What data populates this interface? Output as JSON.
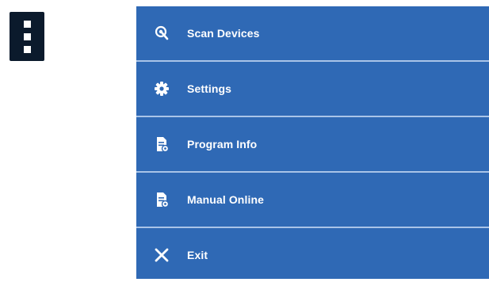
{
  "menu": {
    "items": [
      {
        "label": "Scan Devices",
        "icon": "scan-icon"
      },
      {
        "label": "Settings",
        "icon": "gear-icon"
      },
      {
        "label": "Program Info",
        "icon": "document-icon"
      },
      {
        "label": "Manual Online",
        "icon": "document-icon"
      },
      {
        "label": "Exit",
        "icon": "close-icon"
      }
    ]
  },
  "colors": {
    "menu_background": "#2f69b5",
    "divider": "#a9c4e8",
    "kebab_background": "#0b1a2c",
    "text": "#ffffff"
  }
}
